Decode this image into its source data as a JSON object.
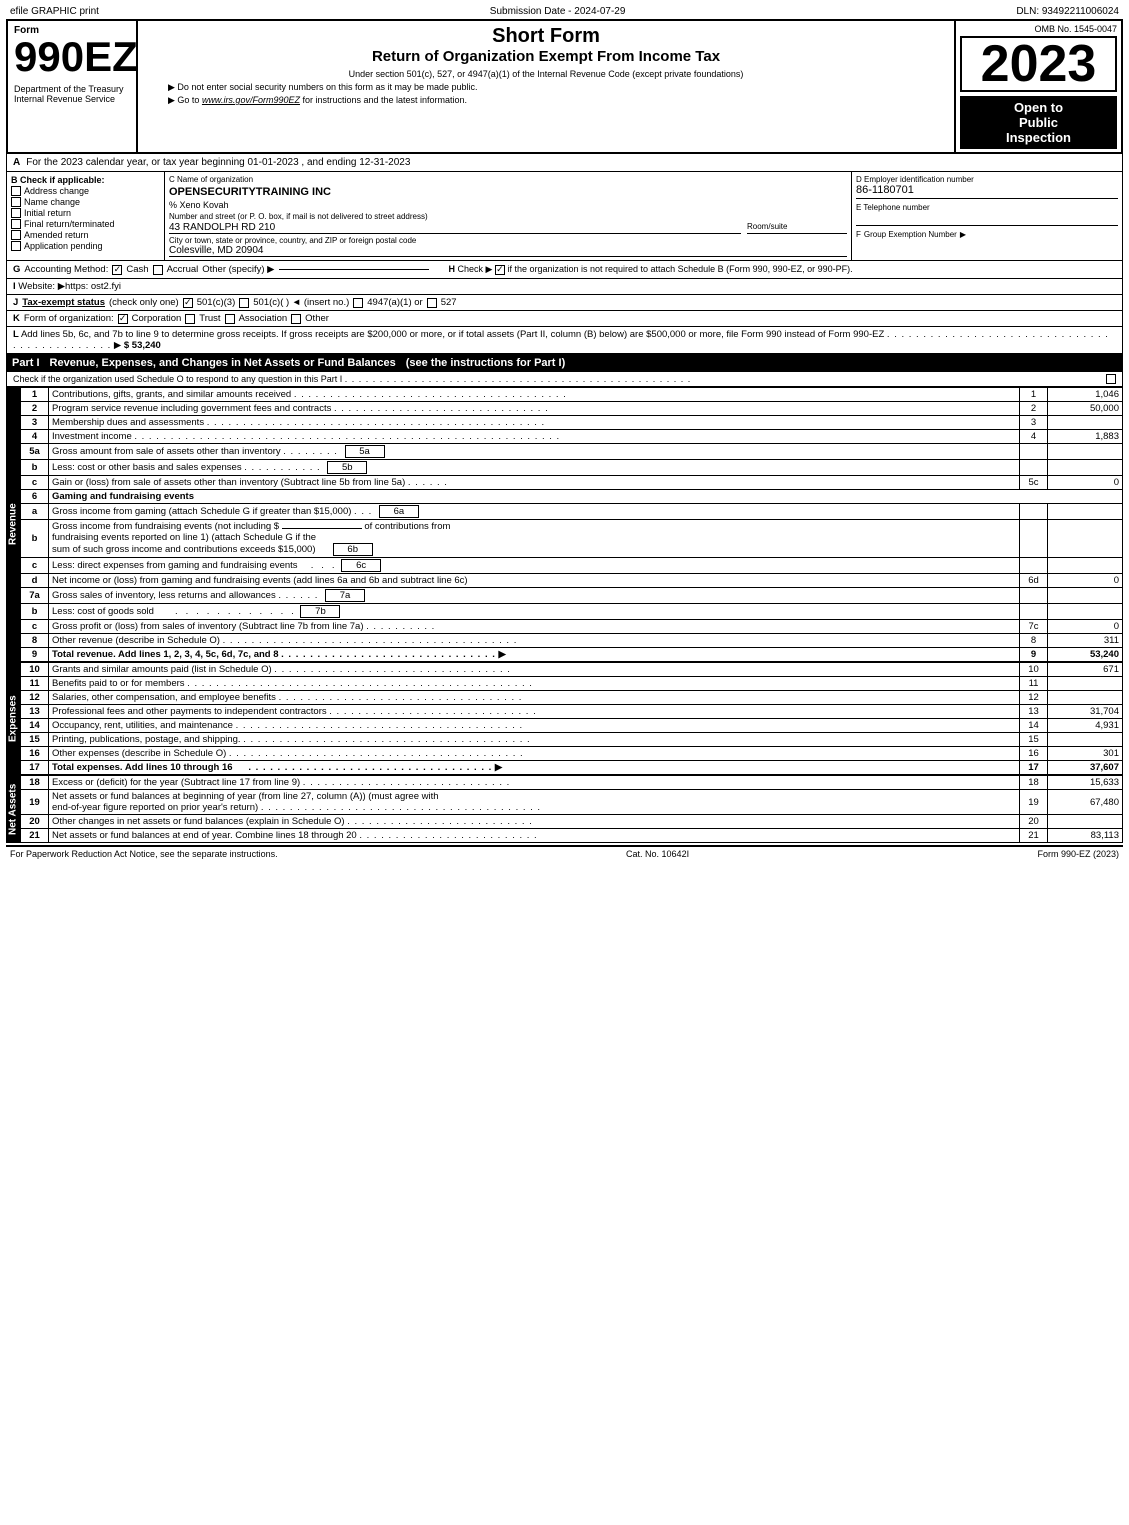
{
  "topbar": {
    "left": "efile GRAPHIC print",
    "center": "Submission Date - 2024-07-29",
    "right": "DLN: 93492211006024"
  },
  "header": {
    "form_number": "990EZ",
    "dept_label": "Department of the Treasury",
    "irs_label": "Internal Revenue Service",
    "short_form": "Short Form",
    "return_title": "Return of Organization Exempt From Income Tax",
    "under_section": "Under section 501(c), 527, or 4947(a)(1) of the Internal Revenue Code (except private foundations)",
    "ssn_note": "▶ Do not enter social security numbers on this form as it may be made public.",
    "goto_note": "▶ Go to www.irs.gov/Form990EZ for instructions and the latest information.",
    "omb": "OMB No. 1545-0047",
    "year": "2023",
    "open_to": "Open to",
    "public": "Public",
    "inspection": "Inspection"
  },
  "section_a": {
    "label": "A",
    "text": "For the 2023 calendar year, or tax year beginning 01-01-2023 , and ending 12-31-2023"
  },
  "section_b": {
    "label": "B",
    "check_label": "Check if applicable:",
    "address_change": "Address change",
    "name_change": "Name change",
    "initial_return": "Initial return",
    "final_return": "Final return/terminated",
    "amended_return": "Amended return",
    "application_pending": "Application pending"
  },
  "section_c": {
    "label": "C",
    "name_label": "Name of organization",
    "org_name": "OPENSECURITYTRAINING INC",
    "attn": "% Xeno Kovah",
    "address_label": "Number and street (or P. O. box, if mail is not delivered to street address)",
    "address": "43 RANDOLPH RD 210",
    "room_label": "Room/suite",
    "city_label": "City or town, state or province, country, and ZIP or foreign postal code",
    "city": "Colesville, MD  20904"
  },
  "section_d": {
    "label": "D",
    "ein_label": "Employer identification number",
    "ein": "86-1180701"
  },
  "section_e": {
    "label": "E",
    "phone_label": "Telephone number"
  },
  "section_f": {
    "label": "F",
    "group_label": "Group Exemption Number",
    "arrow": "▶"
  },
  "section_g": {
    "label": "G",
    "text": "Accounting Method:",
    "cash": "Cash",
    "accrual": "Accrual",
    "other": "Other (specify) ▶",
    "cash_checked": true
  },
  "section_h": {
    "label": "H",
    "text": "Check ▶",
    "checked": true,
    "note": "if the organization is not required to attach Schedule B (Form 990, 990-EZ, or 990-PF)."
  },
  "section_i": {
    "label": "I",
    "text": "Website: ▶https: ost2.fyi"
  },
  "section_j": {
    "label": "J",
    "text": "Tax-exempt status",
    "check_one": "(check only one)",
    "opt1": "501(c)(3)",
    "opt2": "501(c)(   ) ◄ (insert no.)",
    "opt3": "4947(a)(1) or",
    "opt4": "527",
    "opt1_checked": true
  },
  "section_k": {
    "label": "K",
    "text": "Form of organization:",
    "corporation": "Corporation",
    "trust": "Trust",
    "association": "Association",
    "other": "Other",
    "corporation_checked": true
  },
  "section_l": {
    "text": "L Add lines 5b, 6c, and 7b to line 9 to determine gross receipts. If gross receipts are $200,000 or more, or if total assets (Part II, column (B) below) are $500,000 or more, file Form 990 instead of Form 990-EZ",
    "dots": ". . . . . . . . . . . . . . . . . . . . . . . . . . . . . . . . . . . . . . . . . . . .",
    "arrow": "▶",
    "amount": "$ 53,240"
  },
  "part1": {
    "label": "Part I",
    "title": "Revenue, Expenses, and Changes in Net Assets or Fund Balances",
    "see_instructions": "(see the instructions for Part I)",
    "check_note": "Check if the organization used Schedule O to respond to any question in this Part I",
    "dots": ". . . . . . . . . . . . . . . . . . . . . . . . . . . . . . .",
    "rows": [
      {
        "num": "1",
        "label": "Contributions, gifts, grants, and similar amounts received",
        "ref": "",
        "amount": "1,046",
        "bold": false
      },
      {
        "num": "2",
        "label": "Program service revenue including government fees and contracts",
        "ref": "",
        "amount": "50,000",
        "bold": false
      },
      {
        "num": "3",
        "label": "Membership dues and assessments",
        "ref": "",
        "amount": "",
        "bold": false
      },
      {
        "num": "4",
        "label": "Investment income",
        "ref": "",
        "amount": "1,883",
        "bold": false
      },
      {
        "num": "5a",
        "label": "Gross amount from sale of assets other than inventory",
        "ref": "5a",
        "amount": "",
        "bold": false
      },
      {
        "num": "5b",
        "label": "Less: cost or other basis and sales expenses",
        "ref": "5b",
        "amount": "",
        "bold": false
      },
      {
        "num": "5c",
        "label": "Gain or (loss) from sale of assets other than inventory (Subtract line 5b from line 5a)",
        "ref": "",
        "amount": "0",
        "bold": false
      },
      {
        "num": "6",
        "label": "Gaming and fundraising events",
        "ref": "",
        "amount": "",
        "bold": false,
        "section_header": true
      },
      {
        "num": "6a",
        "label": "Gross income from gaming (attach Schedule G if greater than $15,000)",
        "ref": "6a",
        "amount": "",
        "bold": false
      },
      {
        "num": "6b",
        "label": "Gross income from fundraising events (not including $_____ of contributions from fundraising events reported on line 1) (attach Schedule G if the sum of such gross income and contributions exceeds $15,000)",
        "ref": "6b",
        "amount": "",
        "bold": false
      },
      {
        "num": "6c",
        "label": "Less: direct expenses from gaming and fundraising events",
        "ref": "6c",
        "amount": "",
        "bold": false
      },
      {
        "num": "6d",
        "label": "Net income or (loss) from gaming and fundraising events (add lines 6a and 6b and subtract line 6c)",
        "ref": "",
        "amount": "0",
        "bold": false
      },
      {
        "num": "7a",
        "label": "Gross sales of inventory, less returns and allowances",
        "ref": "7a",
        "amount": "",
        "bold": false
      },
      {
        "num": "7b",
        "label": "Less: cost of goods sold",
        "ref": "7b",
        "amount": "",
        "bold": false
      },
      {
        "num": "7c",
        "label": "Gross profit or (loss) from sales of inventory (Subtract line 7b from line 7a)",
        "ref": "",
        "amount": "0",
        "bold": false
      },
      {
        "num": "8",
        "label": "Other revenue (describe in Schedule O)",
        "ref": "",
        "amount": "311",
        "bold": false
      },
      {
        "num": "9",
        "label": "Total revenue. Add lines 1, 2, 3, 4, 5c, 6d, 7c, and 8",
        "ref": "",
        "amount": "53,240",
        "bold": true,
        "arrow": "▶"
      }
    ]
  },
  "expenses": {
    "rows": [
      {
        "num": "10",
        "label": "Grants and similar amounts paid (list in Schedule O)",
        "ref": "",
        "amount": "671",
        "bold": false
      },
      {
        "num": "11",
        "label": "Benefits paid to or for members",
        "ref": "",
        "amount": "",
        "bold": false
      },
      {
        "num": "12",
        "label": "Salaries, other compensation, and employee benefits",
        "ref": "",
        "amount": "",
        "bold": false
      },
      {
        "num": "13",
        "label": "Professional fees and other payments to independent contractors",
        "ref": "",
        "amount": "31,704",
        "bold": false
      },
      {
        "num": "14",
        "label": "Occupancy, rent, utilities, and maintenance",
        "ref": "",
        "amount": "4,931",
        "bold": false
      },
      {
        "num": "15",
        "label": "Printing, publications, postage, and shipping.",
        "ref": "",
        "amount": "",
        "bold": false
      },
      {
        "num": "16",
        "label": "Other expenses (describe in Schedule O)",
        "ref": "",
        "amount": "301",
        "bold": false
      },
      {
        "num": "17",
        "label": "Total expenses. Add lines 10 through 16",
        "ref": "",
        "amount": "37,607",
        "bold": true,
        "arrow": "▶"
      }
    ]
  },
  "net_assets": {
    "rows": [
      {
        "num": "18",
        "label": "Excess or (deficit) for the year (Subtract line 17 from line 9)",
        "ref": "",
        "amount": "15,633",
        "bold": false
      },
      {
        "num": "19",
        "label": "Net assets or fund balances at beginning of year (from line 27, column (A)) (must agree with end-of-year figure reported on prior year's return)",
        "ref": "",
        "amount": "67,480",
        "bold": false
      },
      {
        "num": "20",
        "label": "Other changes in net assets or fund balances (explain in Schedule O)",
        "ref": "",
        "amount": "",
        "bold": false
      },
      {
        "num": "21",
        "label": "Net assets or fund balances at end of year. Combine lines 18 through 20",
        "ref": "",
        "amount": "83,113",
        "bold": false
      }
    ]
  },
  "footer": {
    "paperwork_note": "For Paperwork Reduction Act Notice, see the separate instructions.",
    "cat_no": "Cat. No. 10642I",
    "form_ref": "Form 990-EZ (2023)"
  }
}
